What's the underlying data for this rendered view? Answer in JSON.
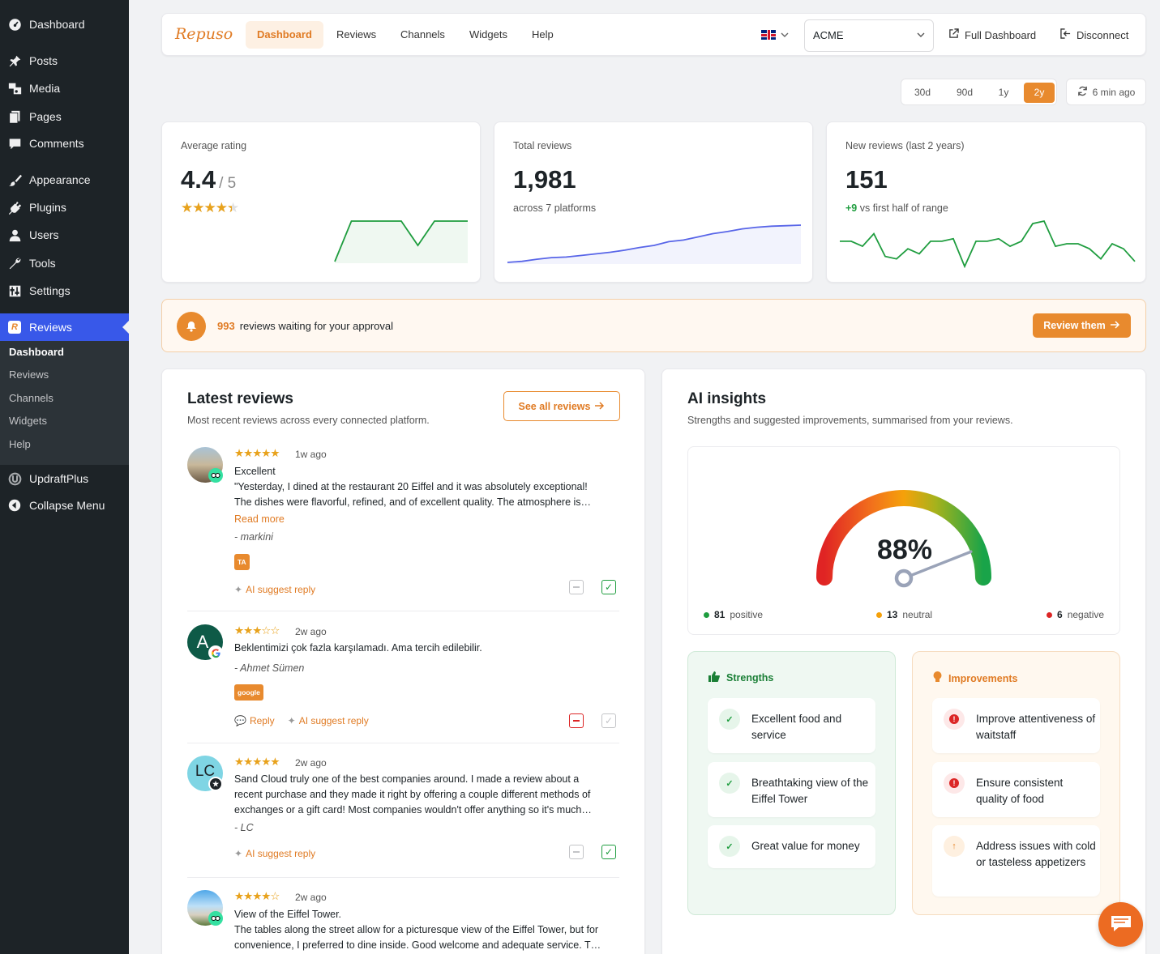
{
  "wp_menu": {
    "items": [
      {
        "label": "Dashboard",
        "icon": "dashboard-icon"
      },
      {
        "label": "Posts",
        "icon": "pin-icon"
      },
      {
        "label": "Media",
        "icon": "media-icon"
      },
      {
        "label": "Pages",
        "icon": "pages-icon"
      },
      {
        "label": "Comments",
        "icon": "comment-icon"
      },
      {
        "label": "Appearance",
        "icon": "brush-icon"
      },
      {
        "label": "Plugins",
        "icon": "plug-icon"
      },
      {
        "label": "Users",
        "icon": "user-icon"
      },
      {
        "label": "Tools",
        "icon": "wrench-icon"
      },
      {
        "label": "Settings",
        "icon": "settings-icon"
      },
      {
        "label": "Reviews",
        "icon": "repuso-icon"
      },
      {
        "label": "UpdraftPlus",
        "icon": "updraft-icon"
      },
      {
        "label": "Collapse Menu",
        "icon": "collapse-icon"
      }
    ],
    "submenu": [
      "Dashboard",
      "Reviews",
      "Channels",
      "Widgets",
      "Help"
    ]
  },
  "topbar": {
    "logo": "Repuso",
    "nav": [
      "Dashboard",
      "Reviews",
      "Channels",
      "Widgets",
      "Help"
    ],
    "account": "ACME",
    "full_dashboard": "Full Dashboard",
    "disconnect": "Disconnect"
  },
  "ranges": [
    "30d",
    "90d",
    "1y",
    "2y"
  ],
  "sync_label": "6 min ago",
  "stats": {
    "avg": {
      "label": "Average rating",
      "value": "4.4",
      "suffix": "/ 5",
      "rating": 4.4,
      "spark": [
        0,
        5,
        5,
        5,
        5,
        2,
        5,
        5,
        5
      ]
    },
    "total": {
      "label": "Total reviews",
      "value": "1,981",
      "sub": "across 7 platforms",
      "spark": [
        0,
        0.4,
        1.2,
        1.8,
        2,
        2.6,
        3.2,
        3.8,
        4.6,
        5.6,
        6.4,
        7.8,
        8.4,
        9.6,
        10.8,
        11.6,
        12.6,
        13.2,
        13.6,
        13.8,
        14
      ]
    },
    "new": {
      "label": "New reviews (last 2 years)",
      "value": "151",
      "delta": "+9",
      "sub": "vs first half of range",
      "spark": [
        6,
        6,
        5,
        7.5,
        3,
        2.5,
        4.5,
        3.5,
        6,
        6,
        6.5,
        1,
        6,
        6,
        6.5,
        5,
        6,
        9.5,
        10,
        5,
        5.5,
        5.5,
        4.5,
        2.5,
        5.5,
        4.5,
        2
      ]
    }
  },
  "banner": {
    "count": "993",
    "text": "reviews waiting for your approval",
    "button": "Review them"
  },
  "latest": {
    "title": "Latest reviews",
    "desc": "Most recent reviews across every connected platform.",
    "see_all": "See all reviews",
    "ai_reply": "AI suggest reply",
    "reply": "Reply",
    "read_more": "Read more",
    "reviews": [
      {
        "stars": "★★★★★",
        "ago": "1w ago",
        "title": "Excellent",
        "text": "\"Yesterday, I dined at the restaurant 20 Eiffel and it was absolutely exceptional! The dishes were flavorful, refined, and of excellent quality. The atmosphere is…",
        "author": "- markini",
        "platform": "TA"
      },
      {
        "stars": "★★★☆☆",
        "ago": "2w ago",
        "text": "Beklentimizi çok fazla karşılamadı. Ama tercih edilebilir.",
        "author": "- Ahmet Sümen",
        "platform": "google",
        "initial": "A"
      },
      {
        "stars": "★★★★★",
        "ago": "2w ago",
        "text": "Sand Cloud truly one of the best companies around. I made a review about a recent purchase and they made it right by offering a couple different methods of exchanges or a gift card! Most companies wouldn't offer anything so it's much…",
        "author": "- LC",
        "initial": "LC"
      },
      {
        "stars": "★★★★☆",
        "ago": "2w ago",
        "title": "View of the Eiffel Tower.",
        "text": "The tables along the street allow for a picturesque view of the Eiffel Tower, but for convenience, I preferred to dine inside. Good welcome and adequate service. T…"
      }
    ]
  },
  "ai": {
    "title": "AI insights",
    "desc": "Strengths and suggested improvements, summarised from your reviews.",
    "score": "88%",
    "score_value": 88,
    "positive": {
      "count": "81",
      "label": "positive"
    },
    "neutral": {
      "count": "13",
      "label": "neutral"
    },
    "negative": {
      "count": "6",
      "label": "negative"
    },
    "strengths_title": "Strengths",
    "strengths": [
      "Excellent food and service",
      "Breathtaking view of the Eiffel Tower",
      "Great value for money"
    ],
    "improvements_title": "Improvements",
    "improvements": [
      "Improve attentiveness of waitstaff",
      "Ensure consistent quality of food",
      "Address issues with cold or tasteless appetizers"
    ]
  },
  "colors": {
    "accent": "#e88a2e",
    "wp_active": "#3858e9",
    "green": "#1f9d3f",
    "blue": "#5865e8",
    "red": "#dc2626"
  }
}
